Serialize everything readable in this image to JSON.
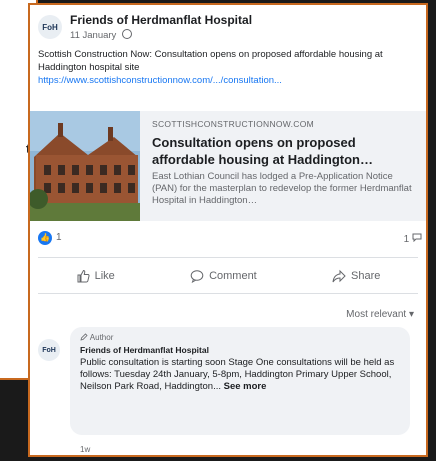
{
  "backdrop": {
    "partial_text": "t"
  },
  "post": {
    "page_name": "Friends of Herdmanflat Hospital",
    "date": "11 January",
    "text": "Scottish Construction Now: Consultation opens on proposed affordable housing at Haddington hospital site",
    "link": "https://www.scottishconstructionnow.com/.../consultation..."
  },
  "preview": {
    "domain": "SCOTTISHCONSTRUCTIONNOW.COM",
    "title": "Consultation opens on proposed affordable housing at Haddington…",
    "description": "East Lothian Council has lodged a Pre-Application Notice (PAN) for the masterplan to redevelop the former Herdmanflat Hospital in Haddington…"
  },
  "reactions": {
    "like_count": "1",
    "comment_count": "1"
  },
  "actions": {
    "like": "Like",
    "comment": "Comment",
    "share": "Share"
  },
  "sort_label": "Most relevant ▾",
  "comment": {
    "author_tag": "Author",
    "name": "Friends of Herdmanflat Hospital",
    "text": "Public consultation is starting soon Stage One consultations will be held as follows: Tuesday 24th January, 5-8pm, Haddington Primary Upper School, Neilson Park Road, Haddington... ",
    "see_more": "See more",
    "time": "1w"
  },
  "icons": [
    "globe-icon",
    "like-icon",
    "comment-icon",
    "share-icon",
    "thumbs-up-badge-icon"
  ]
}
